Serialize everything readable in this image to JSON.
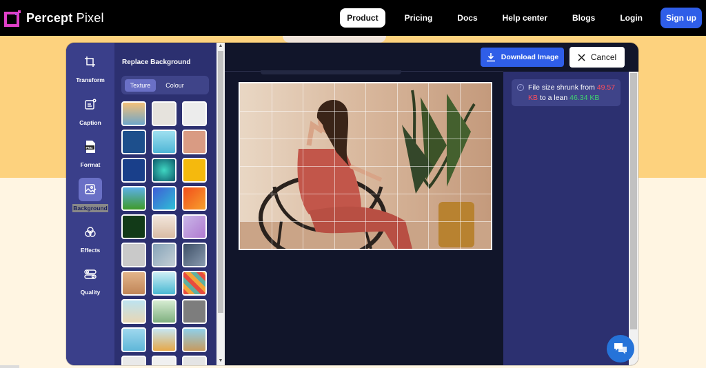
{
  "nav": {
    "brand_bold": "Percept",
    "brand_thin": " Pixel",
    "links": [
      "Product",
      "Pricing",
      "Docs",
      "Help center",
      "Blogs",
      "Login"
    ],
    "active": "Product",
    "signup": "Sign up"
  },
  "tools": [
    {
      "label": "Transform",
      "icon": "crop-icon"
    },
    {
      "label": "Caption",
      "icon": "caption-icon"
    },
    {
      "label": "Format",
      "icon": "png-file-icon"
    },
    {
      "label": "Background",
      "icon": "image-edit-icon",
      "selected": true
    },
    {
      "label": "Effects",
      "icon": "effects-icon"
    },
    {
      "label": "Quality",
      "icon": "sliders-icon"
    }
  ],
  "panel": {
    "title": "Replace Background",
    "tabs": [
      "Texture",
      "Colour"
    ],
    "active_tab": "Texture"
  },
  "actions": {
    "download": "Download Image",
    "cancel": "Cancel"
  },
  "notice": {
    "prefix": "File size shrunk from ",
    "from": "49.57 KB",
    "middle": " to a lean ",
    "to": "46.34 KB"
  },
  "colors": {
    "accent": "#2f5ee8",
    "tool_bg": "#3a3f8a",
    "panel_bg": "#2c3070",
    "stage_bg": "#11152a",
    "size_from": "#ff4d5d",
    "size_to": "#3fd16f"
  }
}
